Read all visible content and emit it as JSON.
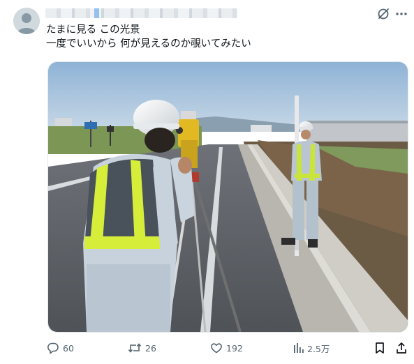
{
  "post": {
    "text_line1": "たまに見る この光景",
    "text_line2": "一度でいいから 何が見えるのか覗いてみたい"
  },
  "media": {
    "description_icon": "photo"
  },
  "actions": {
    "replies": "60",
    "reposts": "26",
    "likes": "192",
    "views": "2.5万"
  },
  "icons": {
    "avatar": "default-avatar-icon",
    "grok": "grok-icon",
    "more": "more-dots-icon",
    "reply": "reply-icon",
    "repost": "repost-icon",
    "like": "heart-icon",
    "views": "views-chart-icon",
    "bookmark": "bookmark-icon",
    "share": "share-icon"
  },
  "colors": {
    "text": "#0f1419",
    "muted": "#536471",
    "accent": "#1d9bf0"
  }
}
